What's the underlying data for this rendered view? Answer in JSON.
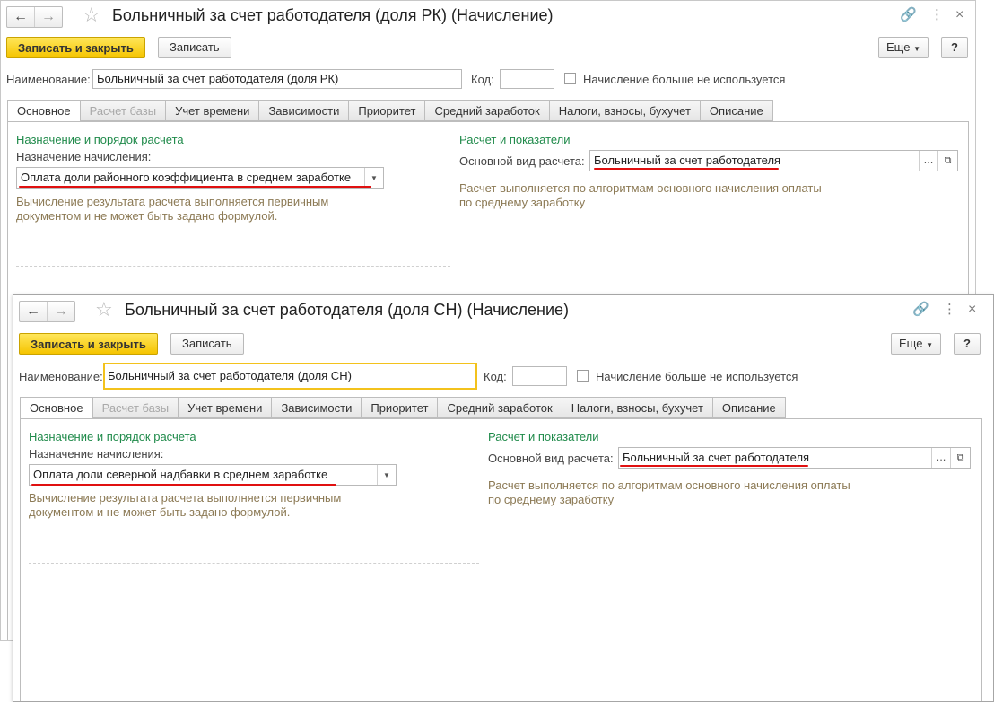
{
  "windows": [
    {
      "title": "Больничный за счет работодателя (доля РК) (Начисление)",
      "toolbar": {
        "save_close": "Записать и закрыть",
        "save": "Записать",
        "more": "Еще",
        "help": "?"
      },
      "name_label": "Наименование:",
      "name_value": "Больничный за счет работодателя (доля РК)",
      "code_label": "Код:",
      "code_value": "",
      "unused_label": "Начисление больше не используется",
      "tabs": [
        "Основное",
        "Расчет базы",
        "Учет времени",
        "Зависимости",
        "Приоритет",
        "Средний заработок",
        "Налоги, взносы, бухучет",
        "Описание"
      ],
      "left_group_title": "Назначение и порядок расчета",
      "purpose_label": "Назначение начисления:",
      "purpose_value": "Оплата доли районного коэффициента в среднем заработке",
      "note_left_1": "Вычисление результата расчета выполняется первичным",
      "note_left_2": "документом и не может быть задано формулой.",
      "right_group_title": "Расчет и показатели",
      "main_calc_label": "Основной вид расчета:",
      "main_calc_value": "Больничный за счет работодателя",
      "note_right_1": "Расчет выполняется по алгоритмам основного начисления оплаты",
      "note_right_2": "по среднему заработку"
    },
    {
      "title": "Больничный за счет работодателя (доля СН) (Начисление)",
      "toolbar": {
        "save_close": "Записать и закрыть",
        "save": "Записать",
        "more": "Еще",
        "help": "?"
      },
      "name_label": "Наименование:",
      "name_value": "Больничный за счет работодателя (доля СН)",
      "code_label": "Код:",
      "code_value": "",
      "unused_label": "Начисление больше не используется",
      "tabs": [
        "Основное",
        "Расчет базы",
        "Учет времени",
        "Зависимости",
        "Приоритет",
        "Средний заработок",
        "Налоги, взносы, бухучет",
        "Описание"
      ],
      "left_group_title": "Назначение и порядок расчета",
      "purpose_label": "Назначение начисления:",
      "purpose_value": "Оплата доли северной надбавки в среднем заработке",
      "note_left_1": "Вычисление результата расчета выполняется первичным",
      "note_left_2": "документом и не может быть задано формулой.",
      "right_group_title": "Расчет и показатели",
      "main_calc_label": "Основной вид расчета:",
      "main_calc_value": "Больничный за счет работодателя",
      "note_right_1": "Расчет выполняется по алгоритмам основного начисления оплаты",
      "note_right_2": "по среднему заработку"
    }
  ],
  "icons": {
    "back": "←",
    "forward": "→",
    "star": "☆",
    "link": "🔗",
    "menu": "⋮",
    "close": "×",
    "dropdown": "▼",
    "dots": "...",
    "open": "⧉"
  },
  "colors": {
    "accent": "#f5c400",
    "group_title": "#1f8a4a",
    "note": "#8c7a55",
    "highlight": "#e01010"
  }
}
